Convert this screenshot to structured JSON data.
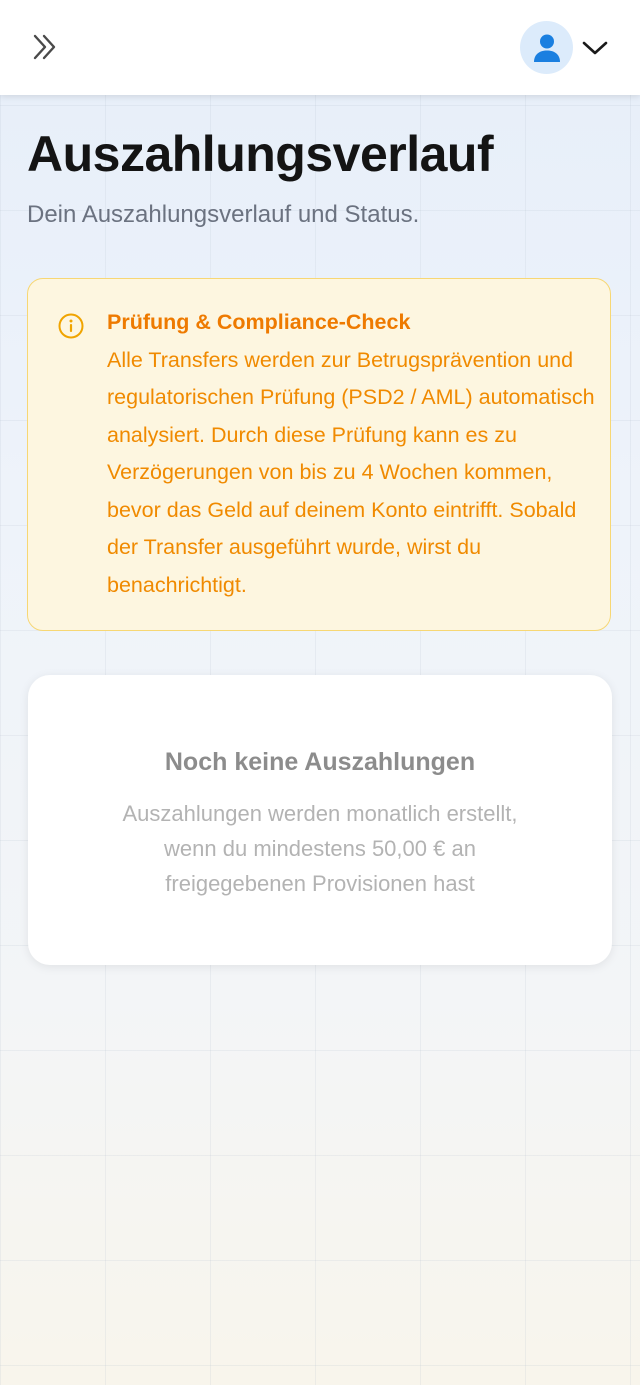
{
  "header": {
    "expand_icon": "double-chevron-right-icon",
    "avatar_icon": "user-icon",
    "menu_icon": "chevron-down-icon",
    "avatar_bg": "#dcebfb",
    "avatar_color": "#1a7fe0"
  },
  "page": {
    "title": "Auszahlungsverlauf",
    "subtitle": "Dein Auszahlungsverlauf und Status."
  },
  "notice": {
    "icon": "info-icon",
    "title": "Prüfung & Compliance-Check",
    "body": "Alle Transfers werden zur Betrugsprävention und regulatorischen Prüfung (PSD2 / AML) automatisch analysiert. Durch diese Prüfung kann es zu Verzögerungen von bis zu 4 Wochen kommen, bevor das Geld auf deinem Konto eintrifft. Sobald der Transfer ausgeführt wurde, wirst du benachrichtigt.",
    "text_color": "#f08a00",
    "background": "#fdf6e0",
    "border_color": "#f7d774"
  },
  "empty_state": {
    "title": "Noch keine Auszahlungen",
    "description": "Auszahlungen werden monatlich erstellt, wenn du mindestens 50,00 € an freigegebenen Provisionen hast"
  }
}
